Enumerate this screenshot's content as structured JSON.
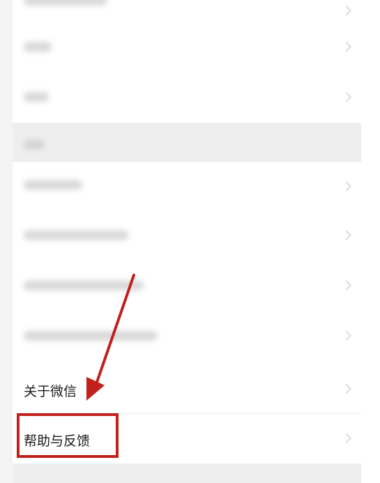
{
  "settings": {
    "items": [
      {
        "label": "关于微信"
      },
      {
        "label": "帮助与反馈"
      }
    ]
  },
  "annotation": {
    "color": "#c1201b",
    "target": "帮助与反馈"
  }
}
